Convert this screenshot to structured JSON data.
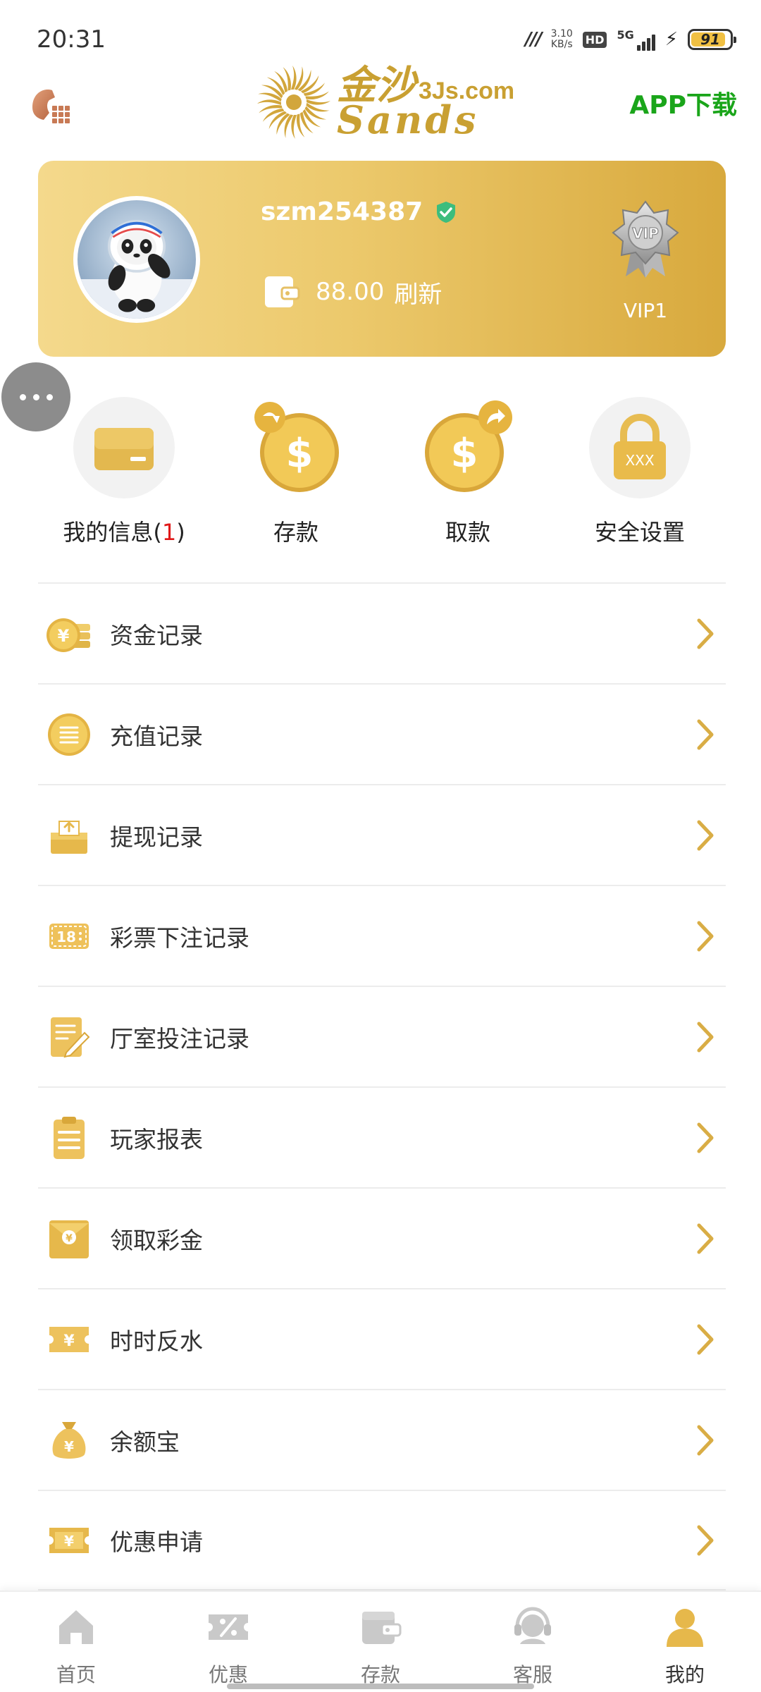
{
  "status_bar": {
    "time": "20:31",
    "carrier_indicator": "ᵢᵢ",
    "speed_value": "3.10",
    "speed_unit": "KB/s",
    "hd": "HD",
    "network": "5G",
    "battery": "91"
  },
  "header": {
    "logo_cn": "金沙",
    "logo_domain": "3Js.com",
    "logo_en": "Sands",
    "app_download": "APP下载",
    "icons": {
      "phone": "phone-icon"
    }
  },
  "profile": {
    "username": "szm254387",
    "balance": "88.00",
    "refresh": "刷新",
    "vip_level": "VIP1",
    "vip_badge_text": "VIP"
  },
  "quick_actions": [
    {
      "label": "我的信息(",
      "badge": "1",
      "suffix": ")",
      "icon": "card-icon"
    },
    {
      "label": "存款",
      "icon": "deposit-coin-icon"
    },
    {
      "label": "取款",
      "icon": "withdraw-coin-icon"
    },
    {
      "label": "安全设置",
      "icon": "lock-icon",
      "lock_text": "XXX"
    }
  ],
  "menu": [
    {
      "label": "资金记录",
      "icon": "yen-coins-icon"
    },
    {
      "label": "充值记录",
      "icon": "list-coin-icon"
    },
    {
      "label": "提现记录",
      "icon": "cash-out-icon"
    },
    {
      "label": "彩票下注记录",
      "icon": "lottery-18-icon",
      "icon_text": "18"
    },
    {
      "label": "厅室投注记录",
      "icon": "note-pen-icon"
    },
    {
      "label": "玩家报表",
      "icon": "clipboard-report-icon"
    },
    {
      "label": "领取彩金",
      "icon": "red-envelope-icon"
    },
    {
      "label": "时时反水",
      "icon": "yen-ticket-icon"
    },
    {
      "label": "余额宝",
      "icon": "money-bag-icon"
    },
    {
      "label": "优惠申请",
      "icon": "coupon-icon"
    }
  ],
  "bottom_nav": [
    {
      "label": "首页",
      "icon": "home-icon"
    },
    {
      "label": "优惠",
      "icon": "discount-ticket-icon"
    },
    {
      "label": "存款",
      "icon": "wallet-icon"
    },
    {
      "label": "客服",
      "icon": "headset-icon"
    },
    {
      "label": "我的",
      "icon": "person-icon",
      "active": true
    }
  ],
  "colors": {
    "gold": "#d9ad45",
    "card_gradient_start": "#f4d98c",
    "card_gradient_end": "#d8a93d",
    "app_download_green": "#1aa51a",
    "badge_red": "#e01818"
  }
}
